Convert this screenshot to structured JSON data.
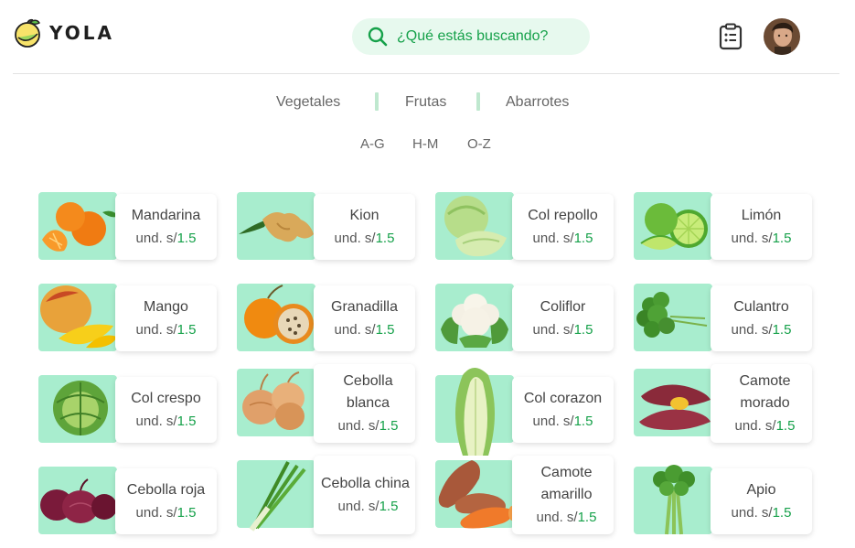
{
  "brand": {
    "name": "YOLA"
  },
  "search": {
    "placeholder": "¿Qué estás buscando?"
  },
  "header": {
    "orders_icon": "clipboard-icon",
    "avatar_icon": "user-avatar"
  },
  "colors": {
    "accent": "#16a14a",
    "tile_bg": "#a8edce",
    "search_bg": "#e7f9ee",
    "separator": "#bfe8cf"
  },
  "categories": [
    "Vegetales",
    "Frutas",
    "Abarrotes"
  ],
  "alpha_filters": [
    "A-G",
    "H-M",
    "O-Z"
  ],
  "price_prefix": "und. s/",
  "products": [
    {
      "name": "Mandarina",
      "price": "1.5",
      "icon": "mandarin-image"
    },
    {
      "name": "Kion",
      "price": "1.5",
      "icon": "ginger-image"
    },
    {
      "name": "Col repollo",
      "price": "1.5",
      "icon": "cabbage-image"
    },
    {
      "name": "Limón",
      "price": "1.5",
      "icon": "lime-image"
    },
    {
      "name": "Mango",
      "price": "1.5",
      "icon": "mango-image"
    },
    {
      "name": "Granadilla",
      "price": "1.5",
      "icon": "granadilla-image"
    },
    {
      "name": "Coliflor",
      "price": "1.5",
      "icon": "cauliflower-image"
    },
    {
      "name": "Culantro",
      "price": "1.5",
      "icon": "cilantro-image"
    },
    {
      "name": "Col crespo",
      "price": "1.5",
      "icon": "savoy-cabbage-image"
    },
    {
      "name": "Cebolla blanca",
      "price": "1.5",
      "icon": "white-onion-image"
    },
    {
      "name": "Col corazon",
      "price": "1.5",
      "icon": "napa-cabbage-image"
    },
    {
      "name": "Camote morado",
      "price": "1.5",
      "icon": "purple-sweet-potato-image"
    },
    {
      "name": "Cebolla roja",
      "price": "1.5",
      "icon": "red-onion-image"
    },
    {
      "name": "Cebolla china",
      "price": "1.5",
      "icon": "scallion-image"
    },
    {
      "name": "Camote amarillo",
      "price": "1.5",
      "icon": "yellow-sweet-potato-image"
    },
    {
      "name": "Apio",
      "price": "1.5",
      "icon": "celery-image"
    }
  ]
}
